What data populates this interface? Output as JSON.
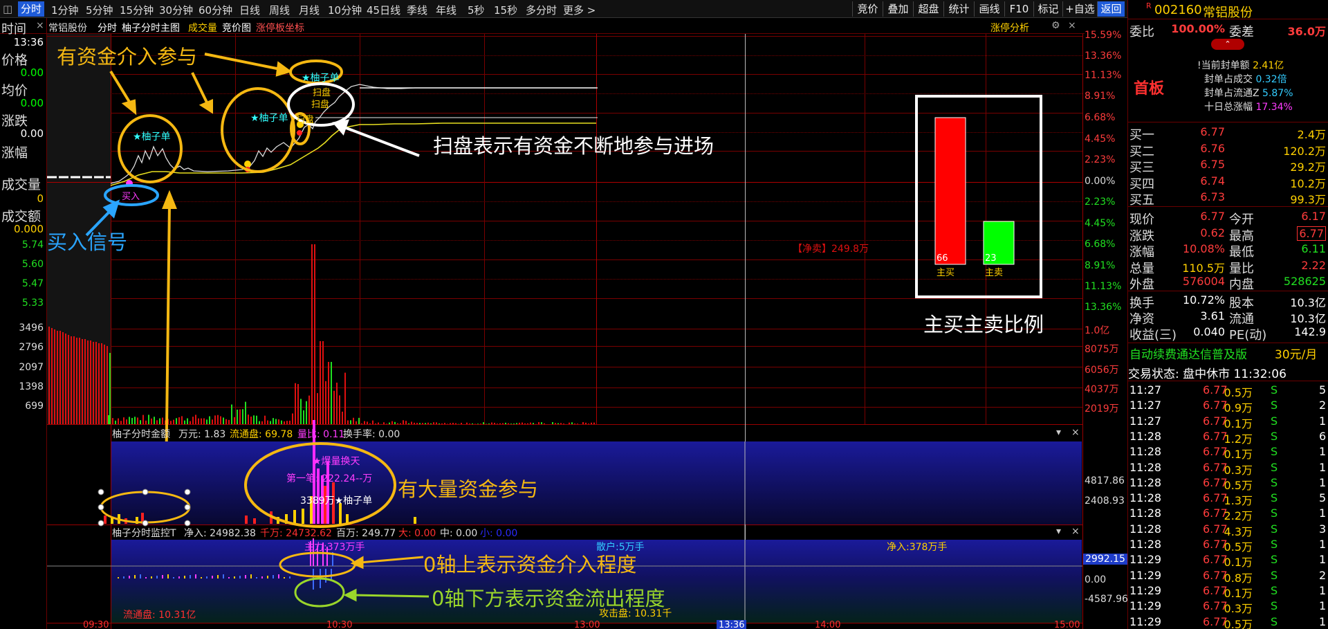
{
  "toolbar": {
    "menu_icon": "◫",
    "tabs": [
      "分时",
      "1分钟",
      "5分钟",
      "15分钟",
      "30分钟",
      "60分钟",
      "日线",
      "周线",
      "月线",
      "10分钟",
      "45日线",
      "季线",
      "年线",
      "5秒",
      "15秒",
      "多分时",
      "更多 >"
    ],
    "right_buttons": [
      "竞价",
      "叠加",
      "超盘",
      "统计",
      "画线",
      "F10",
      "标记",
      "+自选",
      "返回"
    ]
  },
  "stock": {
    "badge": "R",
    "code": "002160",
    "name": "常铝股份"
  },
  "chart_header": {
    "time_label": "时间",
    "close_x": "×",
    "name": "常铝股份",
    "items": [
      "分时",
      "柚子分时主图",
      "成交量",
      "竞价图",
      "涨停板坐标"
    ],
    "zt_link": "涨停分析",
    "gear_icon": "⚙",
    "close2": "×"
  },
  "left_info": {
    "time": "13:36",
    "price_label": "价格",
    "price": "0.00",
    "avg_label": "均价",
    "avg": "0.00",
    "chg_label": "涨跌",
    "chg": "0.00",
    "pct_label": "涨幅",
    "vol_label": "成交量",
    "vol": "0",
    "amt_label": "成交额",
    "amt": "0.000"
  },
  "left_price_ticks": [
    "5.74",
    "5.60",
    "5.47",
    "5.33"
  ],
  "left_vol_ticks": [
    "3496",
    "2796",
    "2097",
    "1398",
    "699"
  ],
  "right_axis_prices": [
    "15.59%",
    "13.36%",
    "11.13%",
    "8.91%",
    "6.68%",
    "4.45%",
    "2.23%",
    "0.00%",
    "2.23%",
    "4.45%",
    "6.68%",
    "8.91%",
    "11.13%",
    "13.36%"
  ],
  "right_axis_vol": [
    "1.0亿",
    "8075万",
    "6056万",
    "4037万",
    "2019万"
  ],
  "sub1": {
    "title": "柚子分时金额",
    "unit": "万元: 1.83",
    "float": "流通盘: 69.78",
    "ratio": "量比: 0.11",
    "turnover": "换手率: 0.00",
    "ticks": [
      "4817.86",
      "2408.93"
    ]
  },
  "sub2": {
    "title": "柚子分时监控T",
    "net": "净入: 24982.38",
    "qian": "千万: 24732.62",
    "bai": "百万: 249.77",
    "da": "大: 0.00",
    "zhong": "中: 0.00",
    "xiao": "小: 0.00",
    "main_force": "主力:373万手",
    "retail": "散户:5万手",
    "net_in": "净入:378万手",
    "float": "流通盘: 10.31亿",
    "attack": "攻击盘: 10.31千",
    "ticks": [
      "2992.15",
      "0.00",
      "-4587.96"
    ]
  },
  "time_axis": [
    "09:30",
    "10:30",
    "13:00",
    "13:36",
    "14:00",
    "15:00"
  ],
  "chart_labels": {
    "youzi1": "★柚子单",
    "youzi2": "★柚子单",
    "youzi3": "★柚子单",
    "saopan1": "扫盘",
    "saopan2": "扫盘",
    "saopan3": "扫盘",
    "buy": "买入",
    "net_sell": "【净卖】249.8万",
    "baoliang": "★爆量换天",
    "first_pen": "第一笔: 222.24--万",
    "amt_label": "3389万★柚子单"
  },
  "ratio_box": {
    "red_val": "66",
    "green_val": "23",
    "red_lab": "主买",
    "green_lab": "主卖"
  },
  "annotations": {
    "a1": "有资金介入参与",
    "a2": "扫盘表示有资金不断地参与进场",
    "a3": "买入信号",
    "a4": "主买主卖比例",
    "a5": "有大量资金参与",
    "a6": "0轴上表示资金介入程度",
    "a7": "0轴下方表示资金流出程度"
  },
  "panel": {
    "weibi_label": "委比",
    "weibi": "100.00%",
    "weicha_label": "委差",
    "weicha": "36.0万",
    "board": "首板",
    "seal_items": [
      {
        "k": "!当前封单额",
        "v": "2.41亿"
      },
      {
        "k": "封单占成交",
        "v": "0.32倍"
      },
      {
        "k": "封单占流通Z",
        "v": "5.87%"
      },
      {
        "k": "十日总涨幅",
        "v": "17.34%"
      }
    ],
    "book": [
      {
        "k": "买一",
        "p": "6.77",
        "v": "2.4万"
      },
      {
        "k": "买二",
        "p": "6.76",
        "v": "120.2万"
      },
      {
        "k": "买三",
        "p": "6.75",
        "v": "29.2万"
      },
      {
        "k": "买四",
        "p": "6.74",
        "v": "10.2万"
      },
      {
        "k": "买五",
        "p": "6.73",
        "v": "99.3万"
      }
    ],
    "stats": [
      {
        "k1": "现价",
        "v1": "6.77",
        "k2": "今开",
        "v2": "6.17"
      },
      {
        "k1": "涨跌",
        "v1": "0.62",
        "k2": "最高",
        "v2": "6.77"
      },
      {
        "k1": "涨幅",
        "v1": "10.08%",
        "k2": "最低",
        "v2": "6.11"
      },
      {
        "k1": "总量",
        "v1": "110.5万",
        "k2": "量比",
        "v2": "2.22"
      },
      {
        "k1": "外盘",
        "v1": "576004",
        "k2": "内盘",
        "v2": "528625"
      }
    ],
    "stats2": [
      {
        "k1": "换手",
        "v1": "10.72%",
        "k2": "股本",
        "v2": "10.3亿"
      },
      {
        "k1": "净资",
        "v1": "3.61",
        "k2": "流通",
        "v2": "10.3亿"
      },
      {
        "k1": "收益(三)",
        "v1": "0.040",
        "k2": "PE(动)",
        "v2": "142.9"
      }
    ],
    "promo": "自动续费通达信普及版",
    "promo_price": "30元/月",
    "trade_state": "交易状态: 盘中休市 11:32:06",
    "ticks": [
      {
        "t": "11:27",
        "p": "6.77",
        "v": "0.5万",
        "s": "S",
        "n": "5"
      },
      {
        "t": "11:27",
        "p": "6.77",
        "v": "0.9万",
        "s": "S",
        "n": "2"
      },
      {
        "t": "11:27",
        "p": "6.77",
        "v": "0.1万",
        "s": "S",
        "n": "1"
      },
      {
        "t": "11:28",
        "p": "6.77",
        "v": "1.2万",
        "s": "S",
        "n": "6"
      },
      {
        "t": "11:28",
        "p": "6.77",
        "v": "0.1万",
        "s": "S",
        "n": "1"
      },
      {
        "t": "11:28",
        "p": "6.77",
        "v": "0.3万",
        "s": "S",
        "n": "1"
      },
      {
        "t": "11:28",
        "p": "6.77",
        "v": "0.5万",
        "s": "S",
        "n": "1"
      },
      {
        "t": "11:28",
        "p": "6.77",
        "v": "1.3万",
        "s": "S",
        "n": "5"
      },
      {
        "t": "11:28",
        "p": "6.77",
        "v": "2.2万",
        "s": "S",
        "n": "1"
      },
      {
        "t": "11:28",
        "p": "6.77",
        "v": "4.3万",
        "s": "S",
        "n": "3"
      },
      {
        "t": "11:28",
        "p": "6.77",
        "v": "0.5万",
        "s": "S",
        "n": "1"
      },
      {
        "t": "11:29",
        "p": "6.77",
        "v": "0.1万",
        "s": "S",
        "n": "1"
      },
      {
        "t": "11:29",
        "p": "6.77",
        "v": "0.8万",
        "s": "S",
        "n": "2"
      },
      {
        "t": "11:29",
        "p": "6.77",
        "v": "0.1万",
        "s": "S",
        "n": "1"
      },
      {
        "t": "11:29",
        "p": "6.77",
        "v": "0.3万",
        "s": "S",
        "n": "1"
      },
      {
        "t": "11:29",
        "p": "6.77",
        "v": "0.5万",
        "s": "S",
        "n": "1"
      }
    ]
  }
}
